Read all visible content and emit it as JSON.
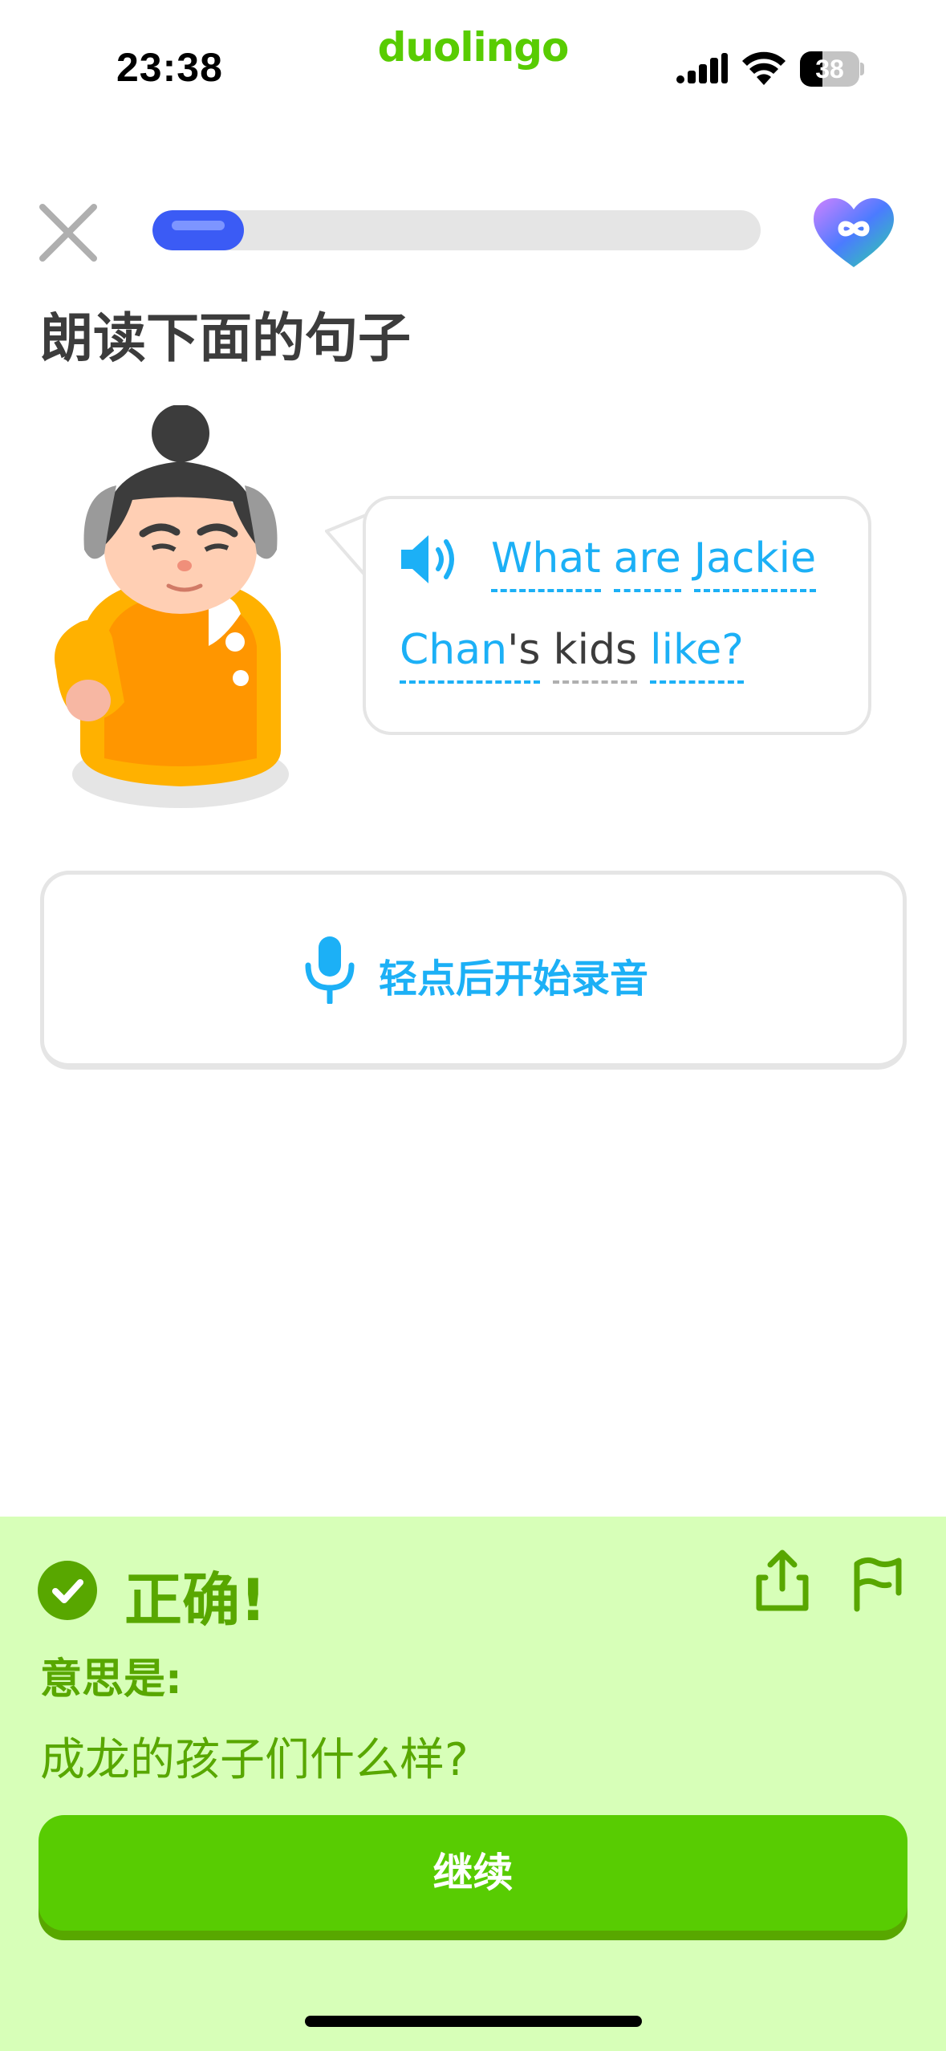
{
  "status_bar": {
    "time": "23:38",
    "brand": "duolingo",
    "battery_level": "38",
    "icons": [
      "signal-icon",
      "wifi-icon",
      "battery-icon"
    ]
  },
  "lesson": {
    "progress_fraction": 0.15,
    "hearts": "infinite",
    "instruction": "朗读下面的句子"
  },
  "prompt": {
    "sentence": "What are Jackie Chan's kids like?",
    "line1": [
      {
        "text": "What",
        "hint": true
      },
      {
        "text": "are",
        "hint": true
      },
      {
        "text": "Jackie",
        "hint": true
      }
    ],
    "line2": {
      "chan": "Chan",
      "apostrophe_s": "'s",
      "kids": "kids",
      "like": "like?"
    }
  },
  "record": {
    "label": "轻点后开始录音"
  },
  "feedback": {
    "title": "正确!",
    "meaning_label": "意思是:",
    "meaning_text": "成龙的孩子们什么样?",
    "continue_label": "继续"
  },
  "colors": {
    "brand_green": "#58cc02",
    "dark_green": "#58a700",
    "feedback_bg": "#d7ffb8",
    "blue": "#1cb0f6",
    "progress_blue": "#3b5bf5",
    "border_gray": "#e5e5e5"
  }
}
